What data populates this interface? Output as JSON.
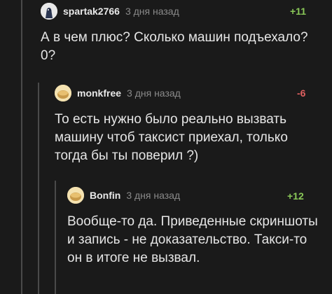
{
  "comments": [
    {
      "username": "spartak2766",
      "time": "3 дня назад",
      "rating": "+11",
      "text": "А в чем плюс? Сколько машин подъехало? 0?",
      "avatar_icon": "bird-avatar-icon"
    },
    {
      "username": "monkfree",
      "time": "3 дня назад",
      "rating": "-6",
      "text": "То есть нужно было реально вызвать машину чтоб таксист приехал, только тогда бы ты поверил ?)",
      "avatar_icon": "default-avatar-icon"
    },
    {
      "username": "Bonfin",
      "time": "3 дня назад",
      "rating": "+12",
      "text": "Вообще-то да. Приведенные скриншоты и запись - не доказательство. Такси-то он в итоге не вызвал.",
      "avatar_icon": "default-avatar-icon"
    }
  ],
  "colors": {
    "positive": "#8ac858",
    "negative": "#e06060",
    "background": "#1a1a1a",
    "thread_line": "#4a4a4a"
  }
}
